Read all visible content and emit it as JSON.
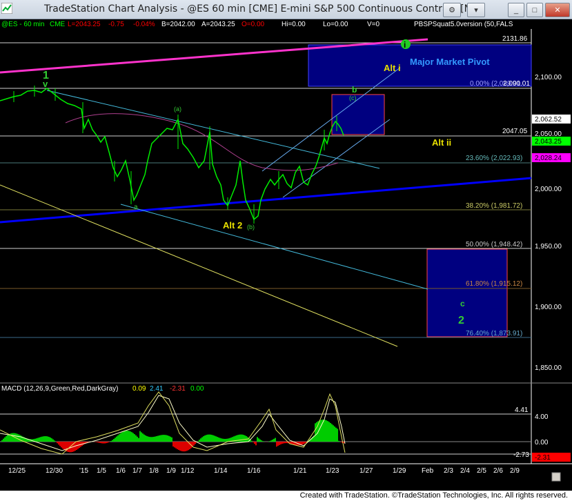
{
  "window": {
    "title": "TradeStation Chart Analysis - @ES 60 min [CME] E-mini S&P 500 Continuous Contract [N",
    "buttons": {
      "min": "_",
      "max": "□",
      "close": "✕"
    },
    "icons": [
      "app-icon",
      "gear-icon",
      "dropdown-icon"
    ]
  },
  "header": {
    "symbol": "@ES - 60 min",
    "exchange": "CME",
    "last": "L=2043.25",
    "change": "-0.75",
    "pct": "-0.04%",
    "bid": "B=2042.00",
    "ask": "A=2043.25",
    "ohlc": "O=0.00",
    "hi": "Hi=0.00",
    "lo": "Lo=0.00",
    "vol": "V=0",
    "indicator": "PBSPSquat5.0version (50,FALS"
  },
  "colors": {
    "up": "#00ff00",
    "down": "#ff0000",
    "price": "#00ff00",
    "magenta": "#ff00ff",
    "blue": "#0000ff",
    "yellow": "#ffff00",
    "cyan": "#00ffff"
  },
  "price_axis": {
    "ticks": [
      "2,100.00",
      "2,050.00",
      "2,000.00",
      "1,950.00",
      "1,900.00",
      "1,850.00"
    ],
    "flags": {
      "p1": "2,062.52",
      "p2": "2,043.25",
      "p3": "2,028.24"
    }
  },
  "levels": {
    "l1": "2131.86",
    "l2": "0.00% (2,089.01",
    "l2b": "2,090.01",
    "l3": "2047.05",
    "l4": "23.60% (2,022.93)",
    "l5": "38.20% (1,981.72)",
    "l6": "50.00% (1,948.42)",
    "l7": "61.80% (1,915.12)",
    "l8": "76.40% (1,873.91)"
  },
  "labels": {
    "pivot": "Major Market Pivot",
    "alt_i": "Alt i",
    "alt_ii": "Alt ii",
    "alt_2": "Alt 2",
    "w1": "1",
    "wv": "v",
    "wa": "(a)",
    "wb": "(b)",
    "wc": "(c)",
    "wbb": "b",
    "wa2": "a",
    "wcc": "c",
    "w2": "2",
    "wi": "i"
  },
  "macd": {
    "title": "MACD (12,26,9,Green,Red,DarkGray)",
    "v1": "0.09",
    "v2": "2.41",
    "v3": "-2.31",
    "v4": "0.00",
    "axis": [
      "4.41",
      "4.00",
      "0.00",
      "-2.73",
      "-2.31"
    ]
  },
  "dates": [
    "12/25",
    "12/30",
    "'15",
    "1/5",
    "1/6",
    "1/7",
    "1/8",
    "1/9",
    "1/12",
    "1/14",
    "1/16",
    "1/21",
    "1/23",
    "1/27",
    "1/29",
    "Feb",
    "2/3",
    "2/4",
    "2/5",
    "2/6",
    "2/9"
  ],
  "footer": "Created with TradeStation. ©TradeStation Technologies, Inc. All rights reserved."
}
